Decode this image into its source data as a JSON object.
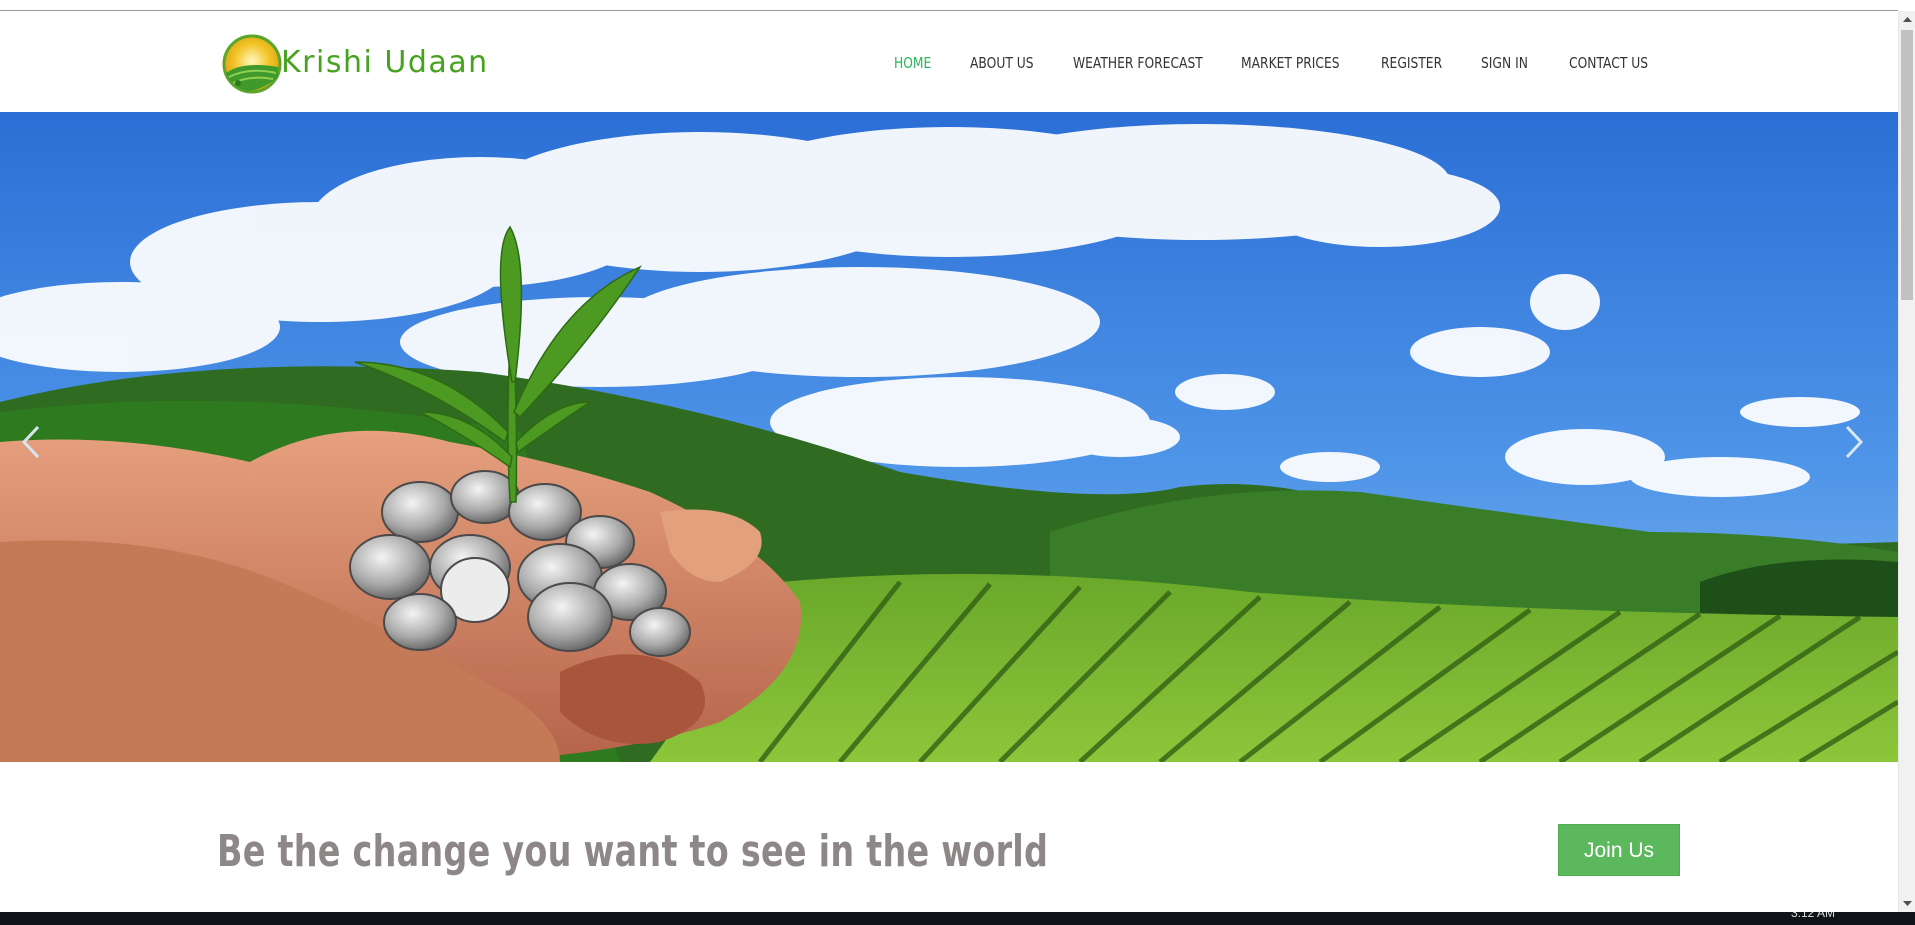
{
  "brand": {
    "name": "Krishi Udaan"
  },
  "nav": {
    "items": [
      {
        "label": "HOME",
        "active": true
      },
      {
        "label": "ABOUT US",
        "active": false
      },
      {
        "label": "WEATHER FORECAST",
        "active": false
      },
      {
        "label": "MARKET PRICES",
        "active": false
      },
      {
        "label": "REGISTER",
        "active": false
      },
      {
        "label": "SIGN IN",
        "active": false
      },
      {
        "label": "CONTACT US",
        "active": false
      }
    ]
  },
  "hero": {
    "prev_icon": "chevron-left-icon",
    "next_icon": "chevron-right-icon"
  },
  "cta": {
    "tagline": "Be the change you want to see in the world",
    "button_label": "Join Us"
  },
  "taskbar": {
    "clock": "3:12 AM"
  },
  "colors": {
    "accent": "#2bb55c",
    "logo": "#47a31f",
    "button": "#5cb85c",
    "tagline": "#8d8887",
    "nav_text": "#333333"
  }
}
